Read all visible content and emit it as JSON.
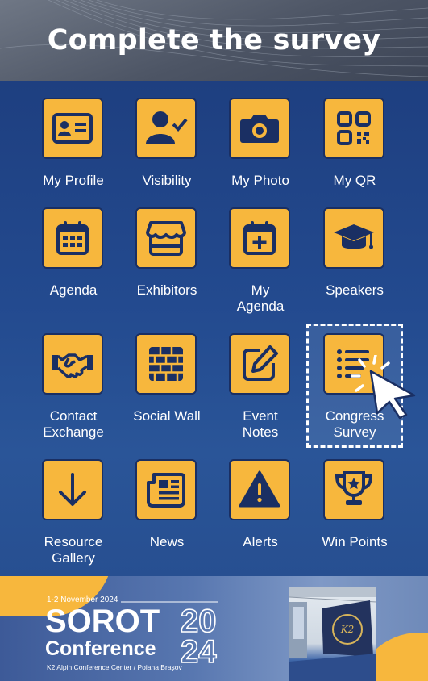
{
  "header": {
    "title": "Complete the survey"
  },
  "tiles": [
    {
      "label": "My Profile",
      "icon": "id-card-icon"
    },
    {
      "label": "Visibility",
      "icon": "user-check-icon"
    },
    {
      "label": "My Photo",
      "icon": "camera-icon"
    },
    {
      "label": "My QR",
      "icon": "qr-code-icon"
    },
    {
      "label": "Agenda",
      "icon": "calendar-icon"
    },
    {
      "label": "Exhibitors",
      "icon": "shop-icon"
    },
    {
      "label": "My\nAgenda",
      "icon": "calendar-plus-icon"
    },
    {
      "label": "Speakers",
      "icon": "graduation-cap-icon"
    },
    {
      "label": "Contact\nExchange",
      "icon": "handshake-icon"
    },
    {
      "label": "Social Wall",
      "icon": "brick-wall-icon"
    },
    {
      "label": "Event\nNotes",
      "icon": "edit-note-icon"
    },
    {
      "label": "Congress\nSurvey",
      "icon": "list-icon"
    },
    {
      "label": "Resource\nGallery",
      "icon": "arrow-down-icon"
    },
    {
      "label": "News",
      "icon": "newspaper-icon"
    },
    {
      "label": "Alerts",
      "icon": "warning-icon"
    },
    {
      "label": "Win Points",
      "icon": "trophy-icon"
    }
  ],
  "footer": {
    "date": "1-2 November 2024",
    "name": "SOROT",
    "year_top": "20",
    "subtitle": "Conference",
    "year_bottom": "24",
    "venue": "K2 Alpin Conference Center / Poiana Brașov",
    "logo_text": "K2"
  },
  "colors": {
    "accent": "#f7b73d",
    "icon": "#1a2f63",
    "header_bg": "#4d5565",
    "main_bg": "#234a8f"
  }
}
